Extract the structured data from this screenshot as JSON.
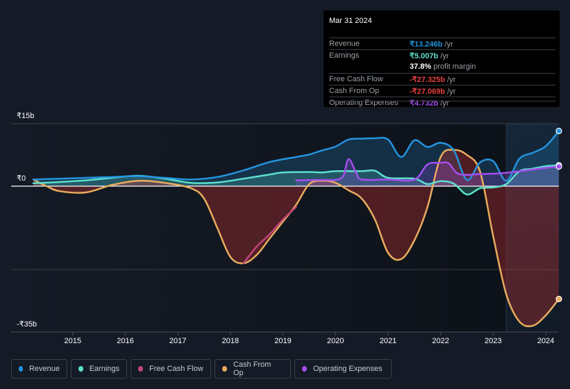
{
  "tooltip": {
    "date": "Mar 31 2024",
    "rows": [
      {
        "label": "Revenue",
        "value": "₹13.246b",
        "suffix": " /yr",
        "color": "#2394df"
      },
      {
        "label": "Earnings",
        "value": "₹5.007b",
        "suffix": " /yr",
        "color": "#5ce0cc"
      },
      {
        "label": "",
        "value": "37.8%",
        "suffix": " profit margin",
        "color": "#ffffff"
      },
      {
        "label": "Free Cash Flow",
        "value": "-₹27.325b",
        "suffix": " /yr",
        "color": "#e64141"
      },
      {
        "label": "Cash From Op",
        "value": "-₹27.069b",
        "suffix": " /yr",
        "color": "#e64141"
      },
      {
        "label": "Operating Expenses",
        "value": "₹4.732b",
        "suffix": " /yr",
        "color": "#a54ef0"
      }
    ]
  },
  "legend": [
    {
      "label": "Revenue",
      "color": "#2394df"
    },
    {
      "label": "Earnings",
      "color": "#5ce0cc"
    },
    {
      "label": "Free Cash Flow",
      "color": "#c2457c"
    },
    {
      "label": "Cash From Op",
      "color": "#e9ac5e"
    },
    {
      "label": "Operating Expenses",
      "color": "#a54ef0"
    }
  ],
  "chart_data": {
    "type": "line",
    "title": "",
    "xlabel": "",
    "ylabel": "",
    "y_tick_labels": [
      "₹15b",
      "₹0",
      "-₹35b"
    ],
    "y_ticks": [
      15,
      0,
      -35
    ],
    "ylim": [
      -35,
      15
    ],
    "xlim": [
      2014.25,
      2024.25
    ],
    "x_tick_labels": [
      "2015",
      "2016",
      "2017",
      "2018",
      "2019",
      "2020",
      "2021",
      "2022",
      "2023",
      "2024"
    ],
    "x_ticks": [
      2015,
      2016,
      2017,
      2018,
      2019,
      2020,
      2021,
      2022,
      2023,
      2024
    ],
    "highlight_from": 2023.25,
    "grid": true,
    "series": [
      {
        "name": "Revenue",
        "color": "#2394df",
        "points": [
          [
            2014.25,
            1.6
          ],
          [
            2014.75,
            1.8
          ],
          [
            2015.25,
            2.0
          ],
          [
            2015.75,
            2.2
          ],
          [
            2016.25,
            2.4
          ],
          [
            2016.75,
            2.0
          ],
          [
            2017.25,
            1.6
          ],
          [
            2017.75,
            2.2
          ],
          [
            2018.25,
            3.8
          ],
          [
            2018.75,
            5.8
          ],
          [
            2019.25,
            7.0
          ],
          [
            2019.5,
            7.6
          ],
          [
            2019.75,
            8.6
          ],
          [
            2020.0,
            9.5
          ],
          [
            2020.25,
            11.2
          ],
          [
            2020.5,
            11.4
          ],
          [
            2020.75,
            11.5
          ],
          [
            2021.0,
            11.2
          ],
          [
            2021.25,
            7.0
          ],
          [
            2021.5,
            11.0
          ],
          [
            2021.75,
            9.4
          ],
          [
            2022.0,
            10.4
          ],
          [
            2022.25,
            8.6
          ],
          [
            2022.5,
            1.5
          ],
          [
            2022.75,
            5.7
          ],
          [
            2023.0,
            6.0
          ],
          [
            2023.25,
            1.3
          ],
          [
            2023.5,
            6.6
          ],
          [
            2023.75,
            8.0
          ],
          [
            2024.0,
            9.6
          ],
          [
            2024.25,
            13.246
          ]
        ]
      },
      {
        "name": "Earnings",
        "color": "#5ce0cc",
        "points": [
          [
            2014.25,
            0.7
          ],
          [
            2014.75,
            1.0
          ],
          [
            2015.25,
            1.4
          ],
          [
            2015.75,
            2.0
          ],
          [
            2016.25,
            2.5
          ],
          [
            2016.75,
            1.8
          ],
          [
            2017.25,
            0.8
          ],
          [
            2017.75,
            0.9
          ],
          [
            2018.25,
            1.8
          ],
          [
            2018.75,
            2.8
          ],
          [
            2019.0,
            3.3
          ],
          [
            2019.5,
            3.4
          ],
          [
            2019.75,
            3.3
          ],
          [
            2020.0,
            3.6
          ],
          [
            2020.5,
            3.6
          ],
          [
            2020.75,
            3.7
          ],
          [
            2021.0,
            2.0
          ],
          [
            2021.5,
            1.8
          ],
          [
            2021.75,
            0.5
          ],
          [
            2022.0,
            1.2
          ],
          [
            2022.25,
            0.6
          ],
          [
            2022.5,
            -2.0
          ],
          [
            2022.75,
            -0.5
          ],
          [
            2023.0,
            -0.3
          ],
          [
            2023.25,
            0.5
          ],
          [
            2023.5,
            3.6
          ],
          [
            2023.75,
            4.2
          ],
          [
            2024.0,
            4.8
          ],
          [
            2024.25,
            5.007
          ]
        ]
      },
      {
        "name": "Free Cash Flow",
        "color": "#c2457c",
        "points": [
          [
            2018.25,
            -18.5
          ],
          [
            2018.5,
            -14.5
          ],
          [
            2018.75,
            -11.5
          ],
          [
            2019.0,
            -8.0
          ],
          [
            2019.25,
            -5.0
          ]
        ]
      },
      {
        "name": "Cash From Op",
        "color": "#e9ac5e",
        "points": [
          [
            2014.25,
            1.6
          ],
          [
            2014.5,
            0.0
          ],
          [
            2014.75,
            -1.2
          ],
          [
            2015.25,
            -1.5
          ],
          [
            2015.75,
            0.3
          ],
          [
            2016.25,
            1.3
          ],
          [
            2016.75,
            0.8
          ],
          [
            2017.25,
            -0.5
          ],
          [
            2017.5,
            -3.0
          ],
          [
            2017.75,
            -10.0
          ],
          [
            2018.0,
            -17.0
          ],
          [
            2018.25,
            -18.5
          ],
          [
            2018.5,
            -16.5
          ],
          [
            2018.75,
            -12.5
          ],
          [
            2019.0,
            -8.5
          ],
          [
            2019.25,
            -4.5
          ],
          [
            2019.5,
            0.5
          ],
          [
            2019.75,
            1.3
          ],
          [
            2020.0,
            0.8
          ],
          [
            2020.25,
            -1.0
          ],
          [
            2020.5,
            -3.0
          ],
          [
            2020.75,
            -8.0
          ],
          [
            2021.0,
            -16.0
          ],
          [
            2021.25,
            -17.5
          ],
          [
            2021.5,
            -13.0
          ],
          [
            2021.75,
            -5.0
          ],
          [
            2022.0,
            7.0
          ],
          [
            2022.25,
            8.7
          ],
          [
            2022.5,
            7.5
          ],
          [
            2022.75,
            3.5
          ],
          [
            2023.0,
            -12.0
          ],
          [
            2023.25,
            -26.0
          ],
          [
            2023.5,
            -32.5
          ],
          [
            2023.75,
            -33.5
          ],
          [
            2024.0,
            -31.0
          ],
          [
            2024.25,
            -27.069
          ]
        ]
      },
      {
        "name": "Operating Expenses",
        "color": "#a54ef0",
        "points": [
          [
            2019.25,
            1.4
          ],
          [
            2019.75,
            1.5
          ],
          [
            2020.0,
            1.5
          ],
          [
            2020.15,
            2.5
          ],
          [
            2020.25,
            6.5
          ],
          [
            2020.4,
            3.0
          ],
          [
            2020.5,
            1.6
          ],
          [
            2021.0,
            1.6
          ],
          [
            2021.5,
            1.6
          ],
          [
            2021.75,
            5.2
          ],
          [
            2022.0,
            5.6
          ],
          [
            2022.15,
            5.5
          ],
          [
            2022.35,
            2.9
          ],
          [
            2022.75,
            2.9
          ],
          [
            2023.0,
            3.0
          ],
          [
            2023.25,
            3.2
          ],
          [
            2023.75,
            4.0
          ],
          [
            2024.0,
            4.4
          ],
          [
            2024.25,
            4.732
          ]
        ]
      }
    ]
  }
}
